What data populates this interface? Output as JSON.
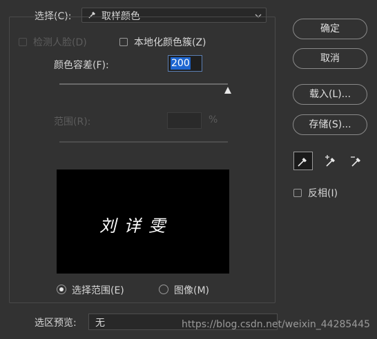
{
  "select": {
    "label": "选择(C):",
    "value": "取样颜色"
  },
  "detect_faces": {
    "label": "检测人脸(D)",
    "checked": false,
    "disabled": true
  },
  "localized_clusters": {
    "label": "本地化颜色簇(Z)",
    "checked": false
  },
  "fuzziness": {
    "label": "颜色容差(F):",
    "value": "200"
  },
  "range": {
    "label": "范围(R):",
    "unit": "%",
    "value": ""
  },
  "preview_text": "刘 详 雯",
  "radio": {
    "selection_label": "选择范围(E)",
    "image_label": "图像(M)",
    "selected": "selection"
  },
  "buttons": {
    "ok": "确定",
    "cancel": "取消",
    "load": "载入(L)...",
    "save": "存储(S)..."
  },
  "tools": [
    "eyedropper-icon",
    "eyedropper-plus-icon",
    "eyedropper-minus-icon"
  ],
  "invert": {
    "label": "反相(I)",
    "checked": false
  },
  "selection_preview": {
    "label": "选区预览:",
    "value": "无"
  },
  "watermark": "https://blog.csdn.net/weixin_44285445"
}
